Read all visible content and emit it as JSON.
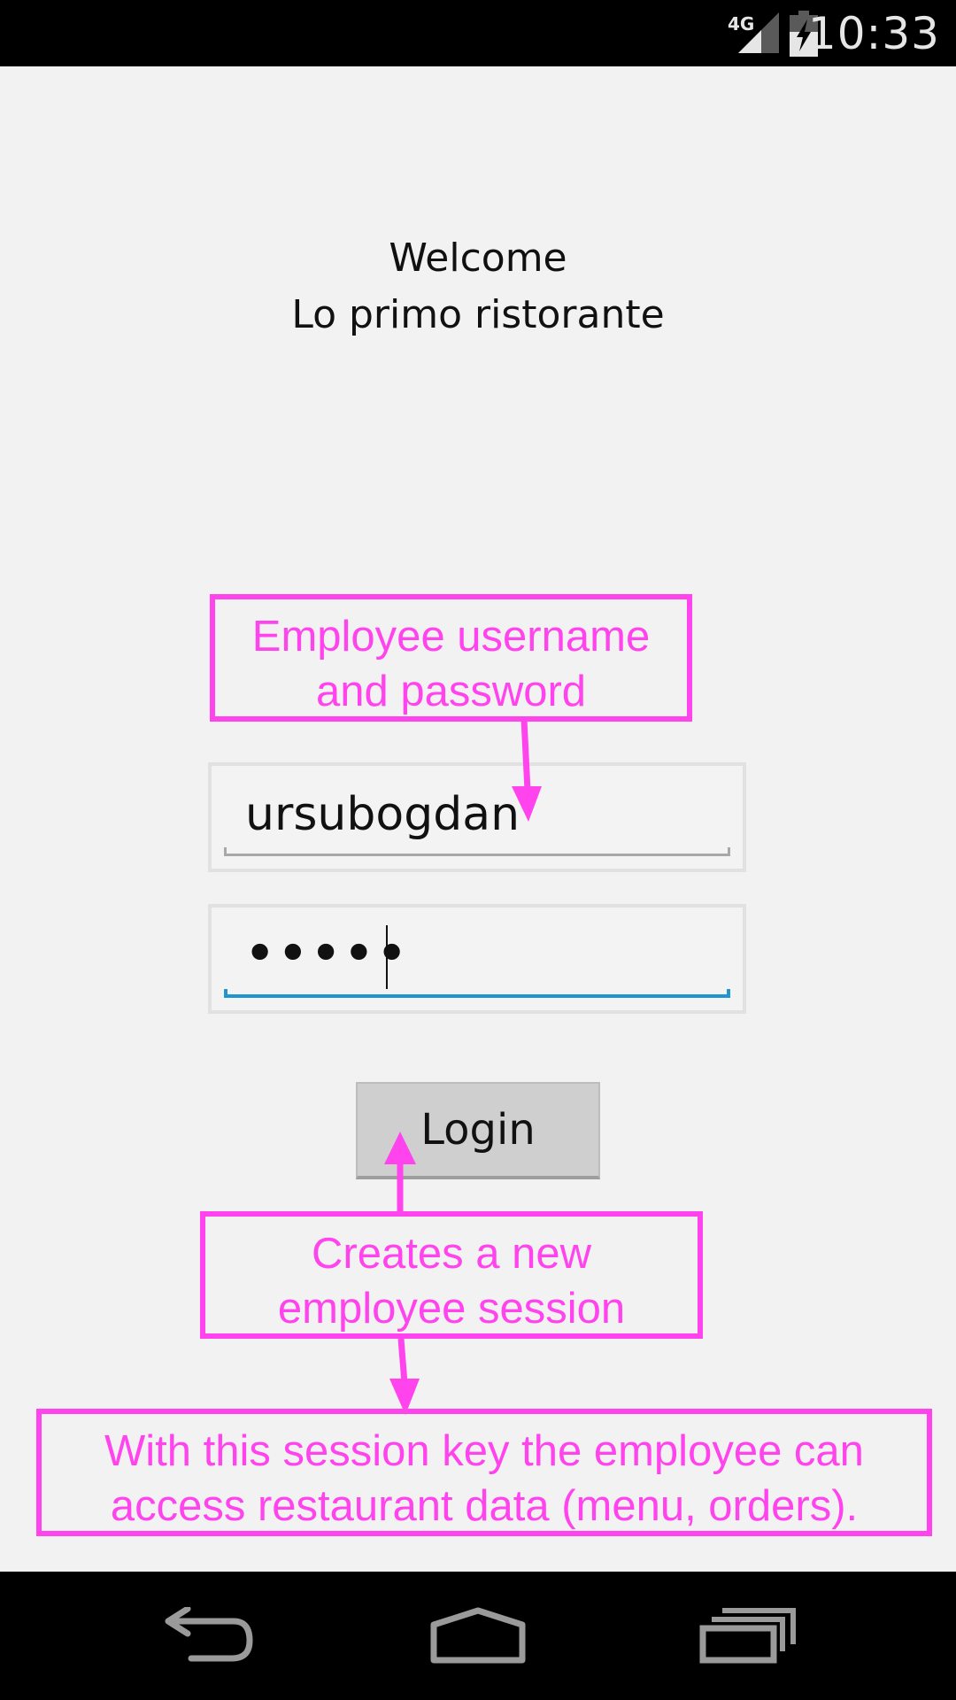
{
  "status_bar": {
    "network": "4G",
    "time": "10:33"
  },
  "welcome": {
    "line1": "Welcome",
    "line2": "Lo primo ristorante"
  },
  "form": {
    "username_value": "ursubogdan",
    "password_masked": "•••••",
    "login_label": "Login"
  },
  "annotations": {
    "credentials": [
      "Employee username",
      "and password"
    ],
    "session": [
      "Creates a new",
      "employee session"
    ],
    "session_key": [
      "With this session key the employee can",
      "access restaurant data (menu, orders)."
    ],
    "color": "#ff44ee"
  },
  "colors": {
    "focus_accent": "#1f96d0",
    "background": "#f2f2f2"
  },
  "navigation": {
    "icons": [
      "back-icon",
      "home-icon",
      "recent-apps-icon"
    ]
  }
}
